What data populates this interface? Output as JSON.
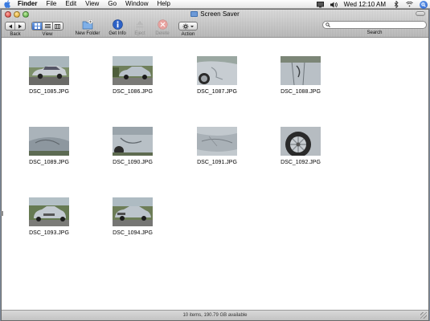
{
  "menubar": {
    "app": "Finder",
    "items": [
      "File",
      "Edit",
      "View",
      "Go",
      "Window",
      "Help"
    ],
    "clock": "Wed 12:10 AM"
  },
  "window": {
    "title": "Screen Saver",
    "toolbar": {
      "back_label": "Back",
      "view_label": "View",
      "new_folder_label": "New Folder",
      "get_info_label": "Get Info",
      "eject_label": "Eject",
      "delete_label": "Delete",
      "action_label": "Action",
      "search_label": "Search",
      "search_value": ""
    },
    "files": [
      {
        "name": "DSC_1085.JPG",
        "thumb": "car-side"
      },
      {
        "name": "DSC_1086.JPG",
        "thumb": "car-street"
      },
      {
        "name": "DSC_1087.JPG",
        "thumb": "car-damage-front"
      },
      {
        "name": "DSC_1088.JPG",
        "thumb": "car-damage-door"
      },
      {
        "name": "DSC_1089.JPG",
        "thumb": "car-dent"
      },
      {
        "name": "DSC_1090.JPG",
        "thumb": "car-dent-close"
      },
      {
        "name": "DSC_1091.JPG",
        "thumb": "car-panel"
      },
      {
        "name": "DSC_1092.JPG",
        "thumb": "car-wheel"
      },
      {
        "name": "DSC_1093.JPG",
        "thumb": "car-front"
      },
      {
        "name": "DSC_1094.JPG",
        "thumb": "car-front-street"
      }
    ],
    "status": "10 items, 190.79 GB available"
  }
}
